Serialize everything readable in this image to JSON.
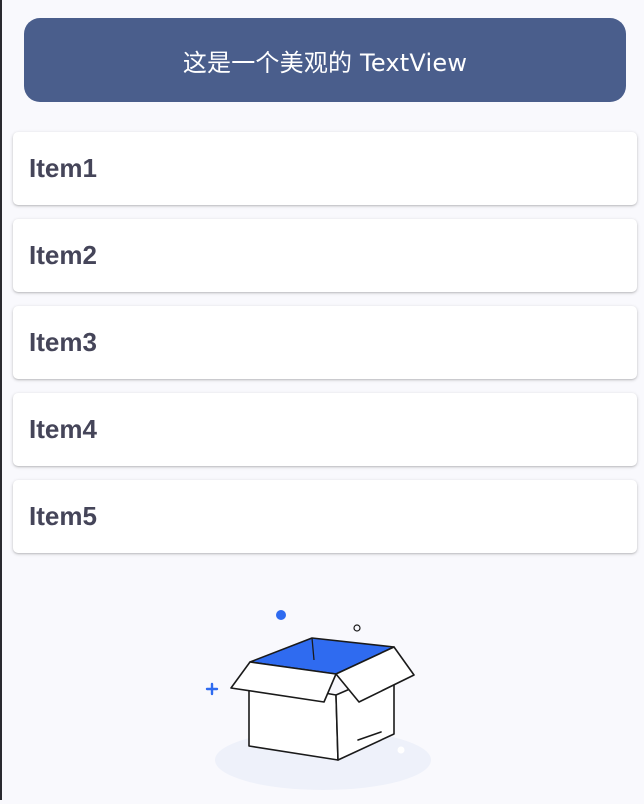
{
  "header": {
    "title": "这是一个美观的 TextView"
  },
  "list": {
    "items": [
      {
        "label": "Item1"
      },
      {
        "label": "Item2"
      },
      {
        "label": "Item3"
      },
      {
        "label": "Item4"
      },
      {
        "label": "Item5"
      }
    ]
  },
  "illustration": {
    "icon": "empty-box-icon",
    "accent_color": "#2f6bf0"
  },
  "colors": {
    "header_bg": "#4a5e8c",
    "background": "#f9f9fd",
    "item_text": "#454559"
  }
}
